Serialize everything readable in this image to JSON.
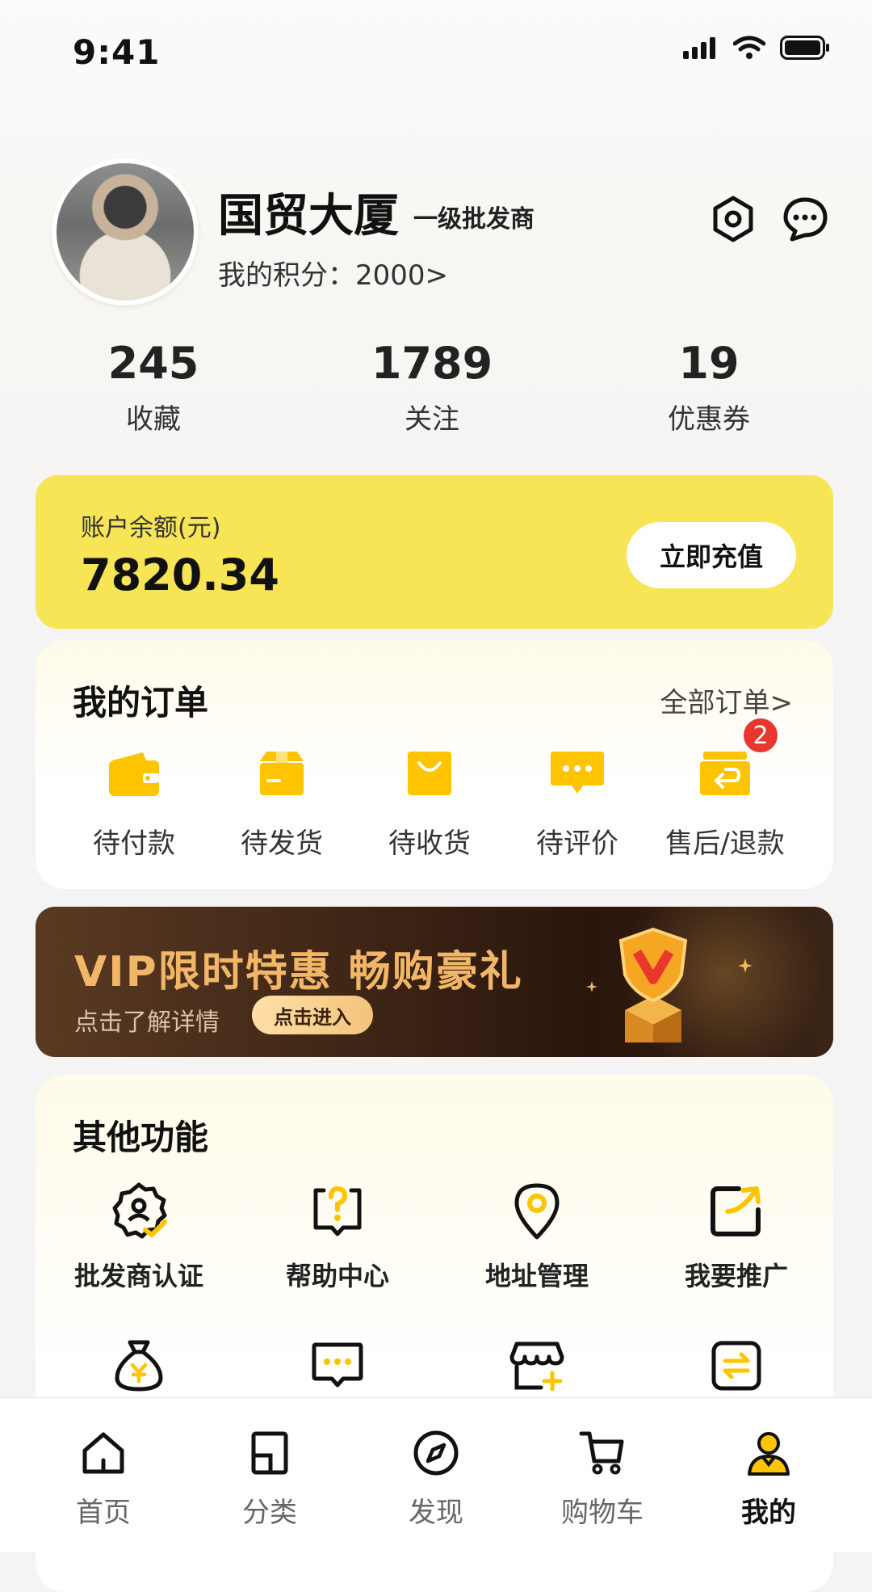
{
  "status_bar": {
    "time": "9:41"
  },
  "profile": {
    "name": "国贸大厦",
    "level": "一级批发商",
    "points_text": "我的积分：2000>"
  },
  "stats": [
    {
      "value": "245",
      "label": "收藏"
    },
    {
      "value": "1789",
      "label": "关注"
    },
    {
      "value": "19",
      "label": "优惠券"
    }
  ],
  "balance": {
    "label": "账户余额(元)",
    "value": "7820.34",
    "button": "立即充值"
  },
  "orders": {
    "title": "我的订单",
    "all_link": "全部订单>",
    "items": [
      {
        "label": "待付款",
        "icon": "wallet-icon"
      },
      {
        "label": "待发货",
        "icon": "package-icon"
      },
      {
        "label": "待收货",
        "icon": "shopping-bag-icon"
      },
      {
        "label": "待评价",
        "icon": "comment-icon"
      },
      {
        "label": "售后/退款",
        "icon": "refund-box-icon",
        "badge": "2"
      }
    ]
  },
  "vip_banner": {
    "title": "VIP限时特惠  畅购豪礼",
    "subtitle": "点击了解详情",
    "button": "点击进入"
  },
  "functions": {
    "title": "其他功能",
    "items": [
      {
        "label": "批发商认证",
        "icon": "certified-badge-icon"
      },
      {
        "label": "帮助中心",
        "icon": "help-icon"
      },
      {
        "label": "地址管理",
        "icon": "location-pin-icon"
      },
      {
        "label": "我要推广",
        "icon": "share-icon"
      },
      {
        "label": "",
        "icon": "money-bag-icon"
      },
      {
        "label": "",
        "icon": "message-icon"
      },
      {
        "label": "",
        "icon": "store-add-icon"
      },
      {
        "label": "",
        "icon": "exchange-icon"
      }
    ]
  },
  "tabbar": {
    "items": [
      {
        "label": "首页",
        "icon": "home-icon"
      },
      {
        "label": "分类",
        "icon": "category-icon"
      },
      {
        "label": "发现",
        "icon": "compass-icon"
      },
      {
        "label": "购物车",
        "icon": "cart-icon"
      },
      {
        "label": "我的",
        "icon": "user-icon",
        "active": true
      }
    ]
  },
  "colors": {
    "accent_yellow": "#F8E555",
    "icon_yellow": "#FFC400",
    "badge_red": "#E9362E",
    "vip_gold": "#F1B766"
  }
}
